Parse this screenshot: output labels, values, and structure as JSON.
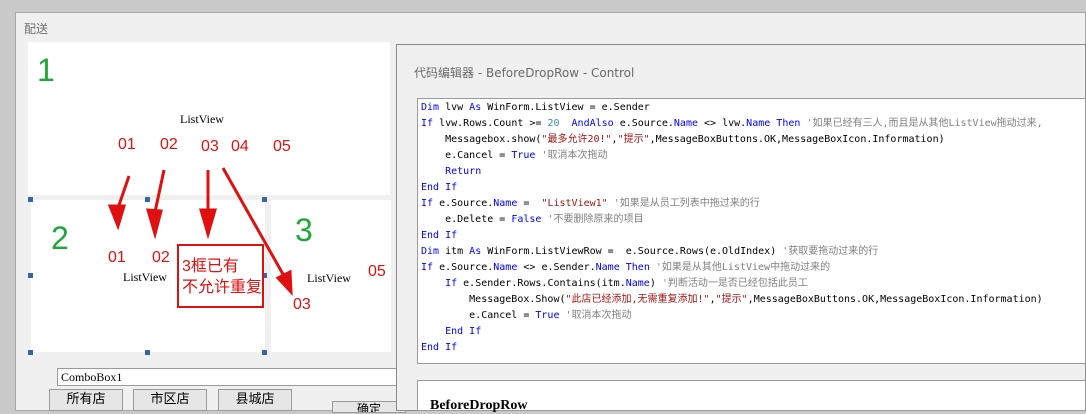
{
  "designer": {
    "title": "配送",
    "listviews": [
      {
        "number": "1",
        "label": "ListView",
        "columns": [
          "01",
          "02",
          "03",
          "04",
          "05"
        ]
      },
      {
        "number": "2",
        "label": "ListView",
        "columns": [
          "01",
          "02"
        ]
      },
      {
        "number": "3",
        "label": "ListView",
        "columns": [
          "05"
        ]
      }
    ],
    "annotation_line1": "3框已有",
    "annotation_line2": "不允许重复",
    "annotation_col": "03",
    "combobox": "ComboBox1",
    "tabs": [
      "所有店",
      "市区店",
      "县城店"
    ],
    "confirm_button": "确定"
  },
  "editor": {
    "title": "代码编辑器 - BeforeDropRow - Control",
    "bottom_title": "BeforeDropRow",
    "code": [
      "Dim lvw As WinForm.ListView = e.Sender",
      "If lvw.Rows.Count >= 20  AndAlso e.Source.Name <> lvw.Name Then '如果已经有三人,而且是从其他ListView拖动过来,",
      "    Messagebox.show(\"最多允许20!\",\"提示\",MessageBoxButtons.OK,MessageBoxIcon.Information)",
      "    e.Cancel = True '取消本次拖动",
      "    Return",
      "End If",
      "If e.Source.Name =  \"ListView1\" '如果是从员工列表中拖过来的行",
      "    e.Delete = False '不要删除原来的项目",
      "End If",
      "Dim itm As WinForm.ListViewRow =  e.Source.Rows(e.OldIndex) '获取要拖动过来的行",
      "If e.Source.Name <> e.Sender.Name Then '如果是从其他ListView中拖动过来的",
      "    If e.Sender.Rows.Contains(itm.Name) '判断活动一是否已经包括此员工",
      "        MessageBox.Show(\"此店已经添加,无需重复添加!\",\"提示\",MessageBoxButtons.OK,MessageBoxIcon.Information)",
      "        e.Cancel = True '取消本次拖动",
      "    End If",
      "End If"
    ]
  },
  "colors": {
    "green": "#1ea838",
    "red": "#e01010",
    "keyword": "#0000ff",
    "string": "#a31515",
    "comment": "#808080"
  }
}
